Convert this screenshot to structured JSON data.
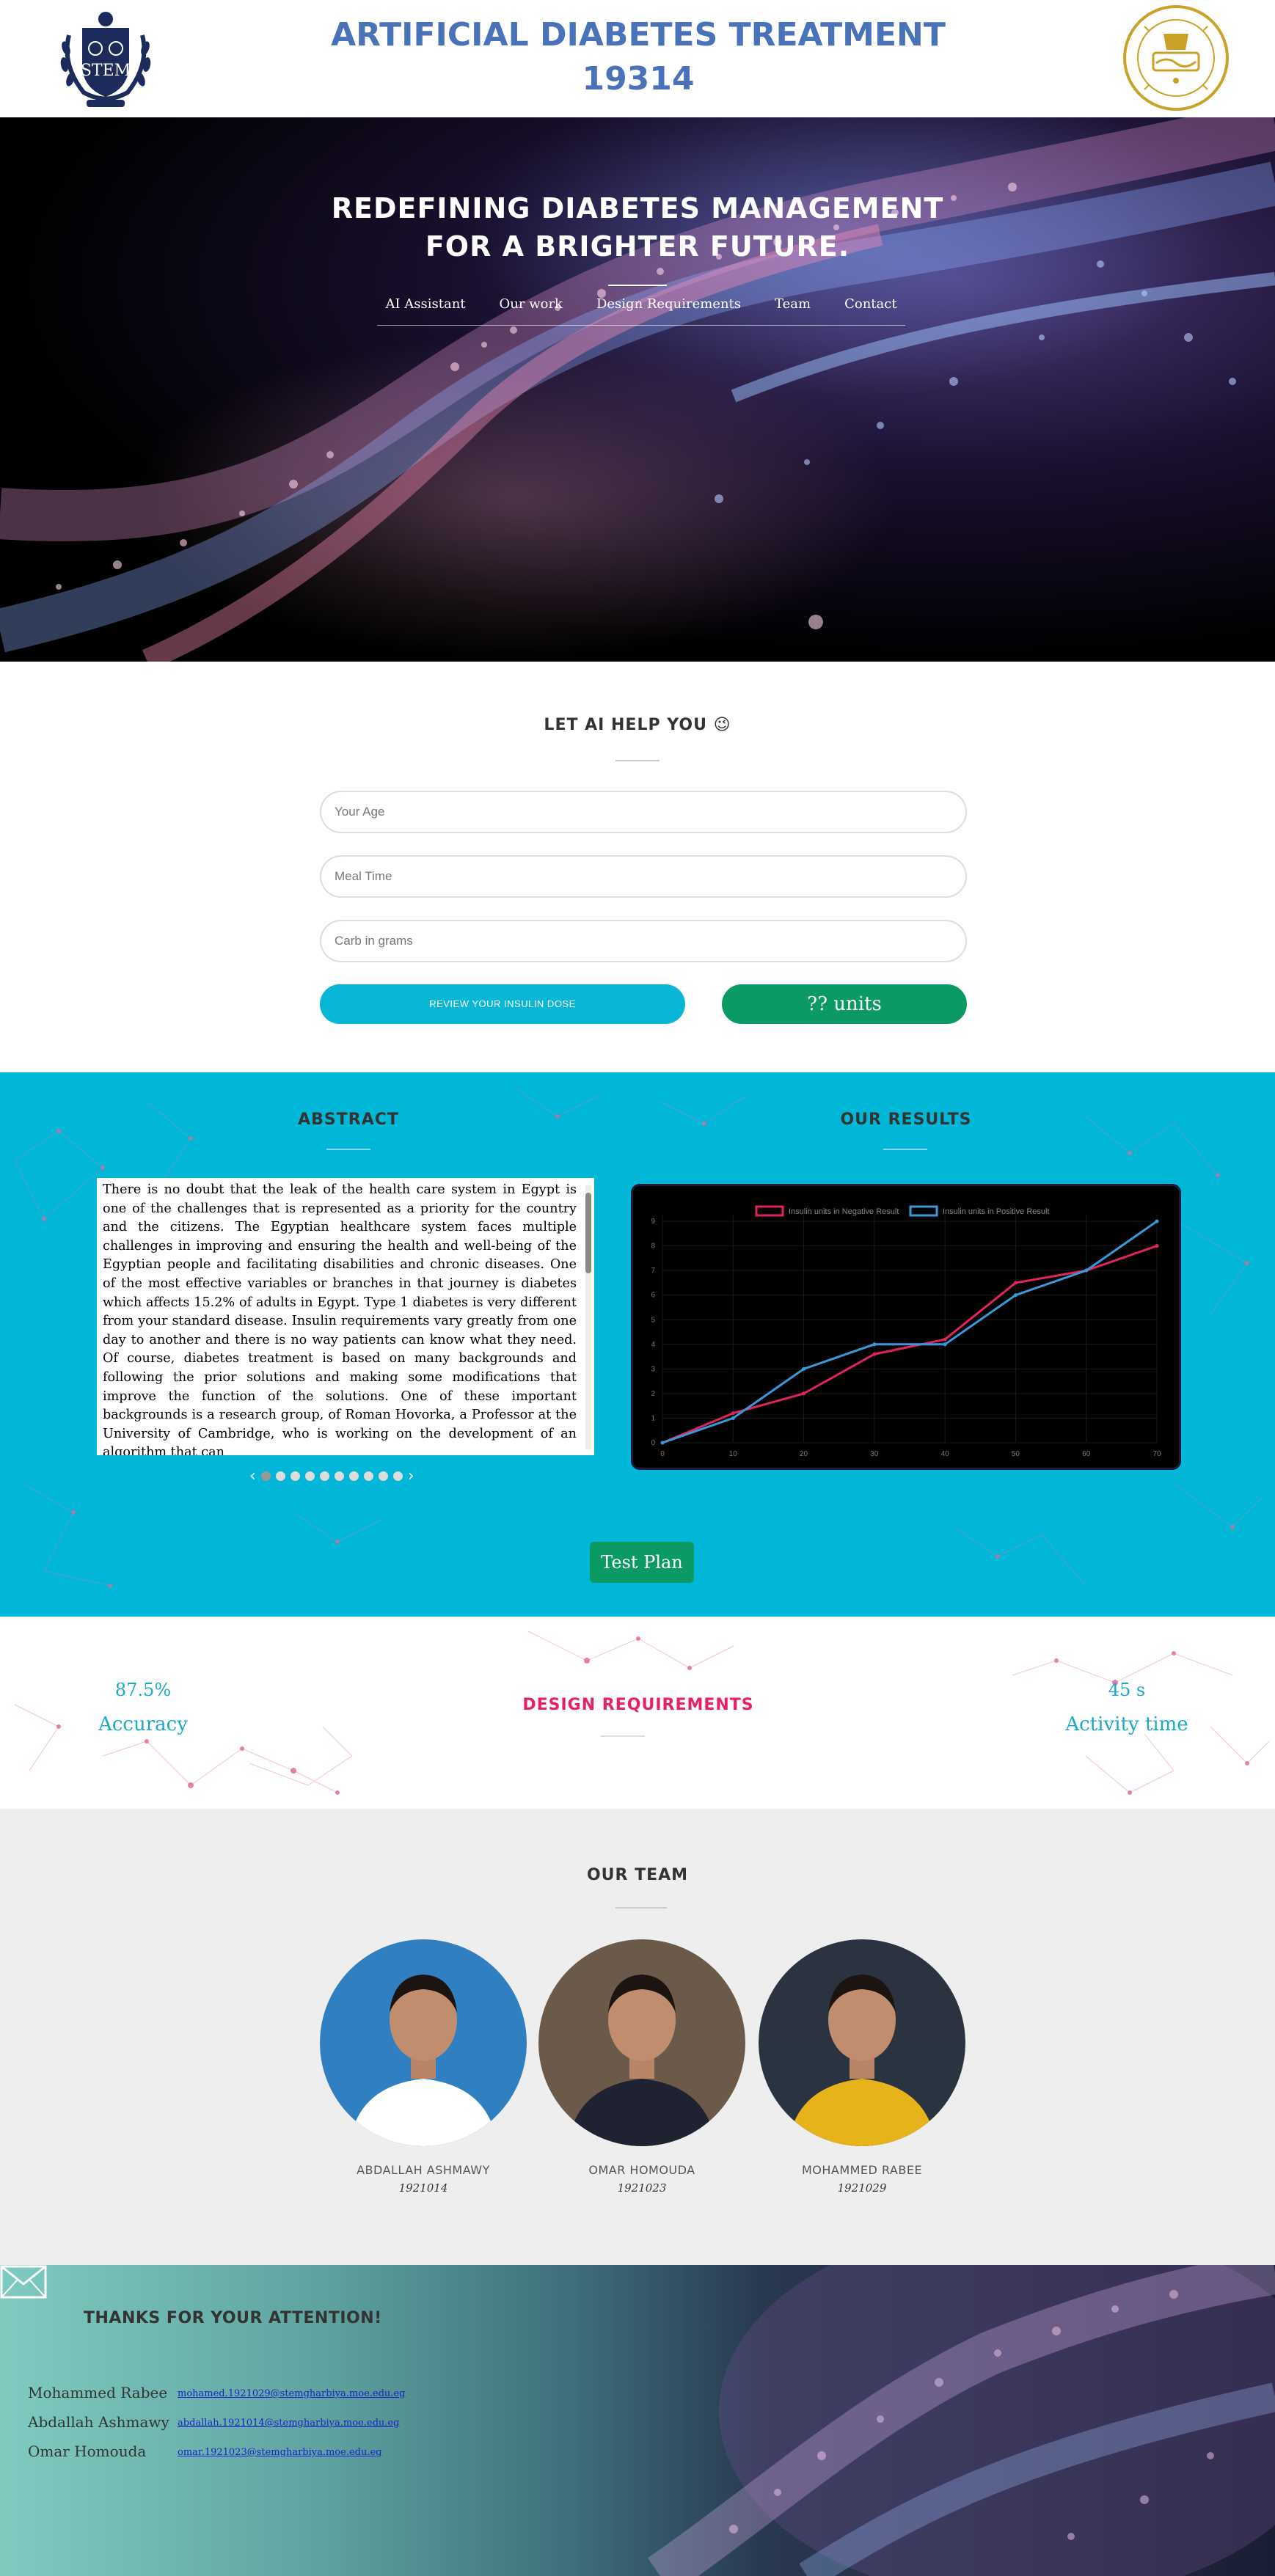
{
  "header": {
    "title_line1": "ARTIFICIAL DIABETES TREATMENT",
    "title_line2": "19314",
    "left_logo_icon": "school-crest-icon",
    "right_logo_icon": "ministry-seal-icon"
  },
  "hero": {
    "title_line1": "REDEFINING DIABETES MANAGEMENT",
    "title_line2": "FOR A BRIGHTER FUTURE.",
    "nav": [
      "AI Assistant",
      "Our work",
      "Design Requirements",
      "Team",
      "Contact"
    ]
  },
  "ai": {
    "title": "LET AI HELP YOU 😉",
    "age_placeholder": "Your Age",
    "meal_placeholder": "Meal Time",
    "carb_placeholder": "Carb in grams",
    "review_label": "REVIEW YOUR INSULIN DOSE",
    "units_label": "?? units"
  },
  "abstract": {
    "title": "ABSTRACT",
    "text": "There is no doubt that the leak of the health care system in Egypt is one of the challenges that is represented as a priority for the country and the citizens. The Egyptian healthcare system faces multiple challenges in improving and ensuring the health and well-being of the Egyptian people and facilitating disabilities and chronic diseases. One of the most effective variables or branches in that journey is diabetes which affects 15.2% of adults in Egypt. Type 1 diabetes is very different from your standard disease. Insulin requirements vary greatly from one day to another and there is no way patients can know what they need. Of course, diabetes treatment is based on many backgrounds and following the prior solutions and making some modifications that improve the function of the solutions. One of these important backgrounds is a research group, of Roman Hovorka, a Professor at the University of Cambridge, who is working on the development of an algorithm that can",
    "carousel_dots": 10,
    "carousel_active": 0
  },
  "results": {
    "title": "OUR RESULTS"
  },
  "chart_data": {
    "type": "line",
    "x": [
      0,
      10,
      20,
      30,
      40,
      50,
      60,
      70
    ],
    "series": [
      {
        "name": "Insulin units in Negative Result",
        "color": "#e0245e",
        "values": [
          0,
          1.2,
          2,
          3.6,
          4.2,
          6.5,
          7,
          8
        ]
      },
      {
        "name": "Insulin units in Positive Result",
        "color": "#3a9ad9",
        "values": [
          0,
          1,
          3,
          4,
          4,
          6,
          7,
          9
        ]
      }
    ],
    "xticks": [
      "0",
      "10",
      "20",
      "30",
      "40",
      "50",
      "60",
      "70"
    ],
    "yticks": [
      "0",
      "1",
      "2",
      "3",
      "4",
      "5",
      "6",
      "7",
      "8",
      "9"
    ],
    "ylim": [
      0,
      9.3
    ],
    "xlim": [
      0,
      70
    ],
    "legend": "top",
    "grid": true
  },
  "test_plan": {
    "label": "Test Plan"
  },
  "design": {
    "title": "DESIGN REQUIREMENTS",
    "metrics": [
      {
        "value": "87.5%",
        "label": "Accuracy"
      },
      {
        "value": "45 s",
        "label": "Activity time"
      }
    ]
  },
  "team": {
    "title": "OUR TEAM",
    "members": [
      {
        "name": "ABDALLAH ASHMAWY",
        "id": "1921014",
        "shirt": "#ffffff",
        "bg": "#2f7fc1"
      },
      {
        "name": "OMAR HOMOUDA",
        "id": "1921023",
        "shirt": "#1f2230",
        "bg": "#6b5a4a"
      },
      {
        "name": "MOHAMMED RABEE",
        "id": "1921029",
        "shirt": "#e6b41a",
        "bg": "#2b3340"
      }
    ]
  },
  "footer": {
    "thanks": "THANKS FOR YOUR ATTENTION!",
    "contacts": [
      {
        "name": "Mohammed Rabee",
        "email": "mohamed.1921029@stemgharbiya.moe.edu.eg"
      },
      {
        "name": "Abdallah Ashmawy",
        "email": "abdallah.1921014@stemgharbiya.moe.edu.eg"
      },
      {
        "name": "Omar Homouda",
        "email": "omar.1921023@stemgharbiya.moe.edu.eg"
      }
    ],
    "mail_icon": "envelope-icon"
  }
}
